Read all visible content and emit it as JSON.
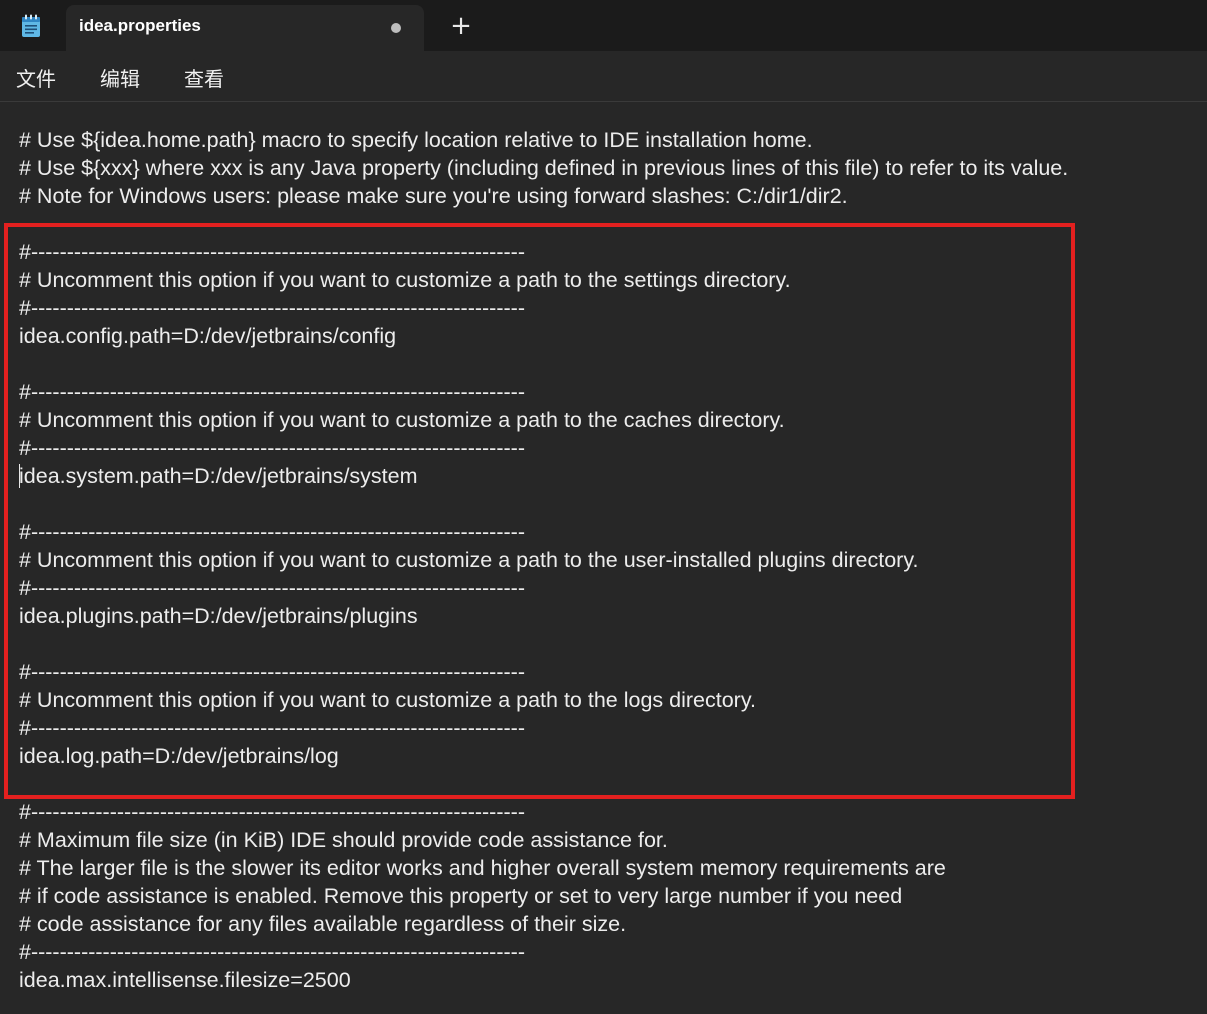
{
  "window": {
    "tab_title": "idea.properties",
    "new_tab_label": "+",
    "app_icon": "notepad-icon",
    "unsaved_indicator": "dot-icon"
  },
  "menu": {
    "file": "文件",
    "edit": "编辑",
    "view": "查看"
  },
  "editor": {
    "lines": [
      "# Use ${idea.home.path} macro to specify location relative to IDE installation home.",
      "# Use ${xxx} where xxx is any Java property (including defined in previous lines of this file) to refer to its value.",
      "# Note for Windows users: please make sure you're using forward slashes: C:/dir1/dir2.",
      "",
      "#---------------------------------------------------------------------",
      "# Uncomment this option if you want to customize a path to the settings directory.",
      "#---------------------------------------------------------------------",
      "idea.config.path=D:/dev/jetbrains/config",
      "",
      "#---------------------------------------------------------------------",
      "# Uncomment this option if you want to customize a path to the caches directory.",
      "#---------------------------------------------------------------------",
      "idea.system.path=D:/dev/jetbrains/system",
      "",
      "#---------------------------------------------------------------------",
      "# Uncomment this option if you want to customize a path to the user-installed plugins directory.",
      "#---------------------------------------------------------------------",
      "idea.plugins.path=D:/dev/jetbrains/plugins",
      "",
      "#---------------------------------------------------------------------",
      "# Uncomment this option if you want to customize a path to the logs directory.",
      "#---------------------------------------------------------------------",
      "idea.log.path=D:/dev/jetbrains/log",
      "",
      "#---------------------------------------------------------------------",
      "# Maximum file size (in KiB) IDE should provide code assistance for.",
      "# The larger file is the slower its editor works and higher overall system memory requirements are",
      "# if code assistance is enabled. Remove this property or set to very large number if you need",
      "# code assistance for any files available regardless of their size.",
      "#---------------------------------------------------------------------",
      "idea.max.intellisense.filesize=2500"
    ]
  },
  "colors": {
    "titlebar_bg": "#1b1b1b",
    "editor_bg": "#272727",
    "text": "#ededed",
    "highlight_border": "#e3201f"
  }
}
